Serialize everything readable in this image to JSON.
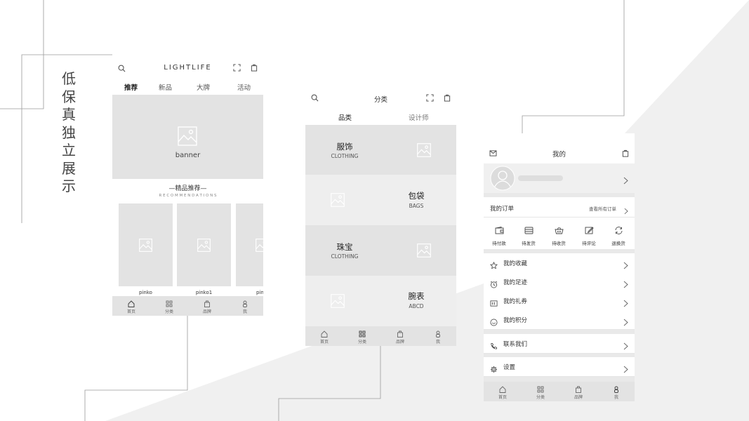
{
  "title_chars": [
    "低",
    "保",
    "真",
    "独",
    "立",
    "展",
    "示"
  ],
  "colors": {
    "bg_shape": "#f0f0f0",
    "placeholder": "#e3e3e3",
    "line": "#9a9a9a"
  },
  "home": {
    "brand": "LIGHTLIFE",
    "tabs": [
      "推荐",
      "新品",
      "大牌",
      "活动"
    ],
    "banner_label": "banner",
    "section_title": "—精品推荐—",
    "section_sub": "R E C O M M E N D A T I O N S",
    "products": [
      "pinko",
      "pinko1",
      "pin"
    ]
  },
  "category": {
    "title": "分类",
    "tabs": [
      "品类",
      "设计师"
    ],
    "items": [
      {
        "name": "服饰",
        "sub": "CLOTHING"
      },
      {
        "name": "包袋",
        "sub": "BAGS"
      },
      {
        "name": "珠宝",
        "sub": "CLOTHING"
      },
      {
        "name": "腕表",
        "sub": "ABCD"
      }
    ]
  },
  "profile": {
    "title": "我的",
    "orders_label": "我的订单",
    "orders_all": "查看所有订单",
    "order_status": [
      "待付款",
      "待发货",
      "待收货",
      "待评论",
      "退换货"
    ],
    "menu": [
      "我的收藏",
      "我的足迹",
      "我的礼券",
      "我的积分"
    ],
    "contact": "联系我们",
    "settings": "设置"
  },
  "tabbar": [
    "首页",
    "分类",
    "品牌",
    "我"
  ]
}
